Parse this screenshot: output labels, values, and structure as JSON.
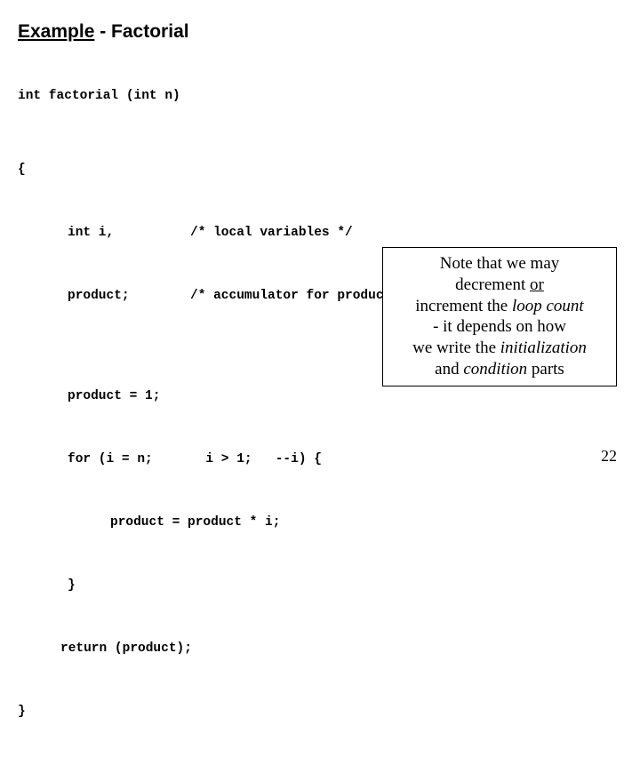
{
  "title": {
    "underlined": "Example",
    "rest": " - Factorial"
  },
  "code": {
    "sig": "int factorial (int n)",
    "brace_open": "{",
    "decl1_left": "int i,",
    "decl1_right": "/* local variables */",
    "decl2_left": "product;",
    "decl2_right": "/* accumulator for product computation */",
    "stmt1": "product = 1;",
    "for_part1": "for (i = n;",
    "for_part2": "  i > 1;   --i) {",
    "body": "product = product * i;",
    "inner_close": "}",
    "ret": "return (product);",
    "brace_close": "}"
  },
  "note": {
    "l1a": "Note that we may",
    "l2a": "decrement ",
    "l2u": "or",
    "l3a": "increment the ",
    "l3i": "loop count",
    "l4a": "- it depends on how",
    "l5a": "we write the ",
    "l5i": "initialization",
    "l6a": "and ",
    "l6i": "condition",
    "l6b": " parts"
  },
  "page": "22"
}
